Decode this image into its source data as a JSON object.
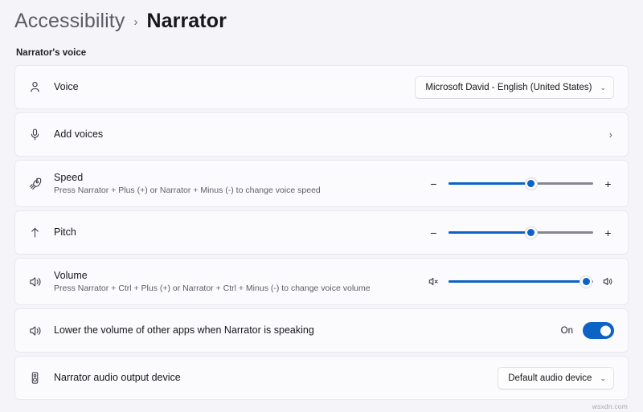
{
  "breadcrumb": {
    "parent": "Accessibility",
    "separator": "›",
    "current": "Narrator"
  },
  "section": {
    "heading": "Narrator's voice"
  },
  "rows": {
    "voice": {
      "icon": "person-icon",
      "title": "Voice",
      "dropdown_value": "Microsoft David - English (United States)",
      "chevron": "⌄"
    },
    "add_voices": {
      "icon": "microphone-icon",
      "title": "Add voices",
      "chevron": "›"
    },
    "speed": {
      "icon": "speed-icon",
      "title": "Speed",
      "subtitle": "Press Narrator + Plus (+) or Narrator + Minus (-) to change voice speed",
      "minus_label": "−",
      "plus_label": "+",
      "value_percent": 57
    },
    "pitch": {
      "icon": "arrow-up-icon",
      "title": "Pitch",
      "minus_label": "−",
      "plus_label": "+",
      "value_percent": 57
    },
    "volume": {
      "icon": "speaker-icon",
      "title": "Volume",
      "subtitle": "Press Narrator + Ctrl + Plus (+) or Narrator + Ctrl + Minus (-) to change voice volume",
      "mute_icon": "speaker-mute-icon",
      "loud_icon": "speaker-loud-icon",
      "value_percent": 95
    },
    "lower_volume": {
      "icon": "speaker-icon",
      "title": "Lower the volume of other apps when Narrator is speaking",
      "toggle_state": "On"
    },
    "audio_device": {
      "icon": "audio-device-icon",
      "title": "Narrator audio output device",
      "dropdown_value": "Default audio device",
      "chevron": "⌄"
    }
  },
  "watermark": "wsxdn.com",
  "colors": {
    "accent": "#0d62c6",
    "page_background": "#f4f4f9",
    "card_background": "#fbfbfd",
    "track": "#868690"
  }
}
